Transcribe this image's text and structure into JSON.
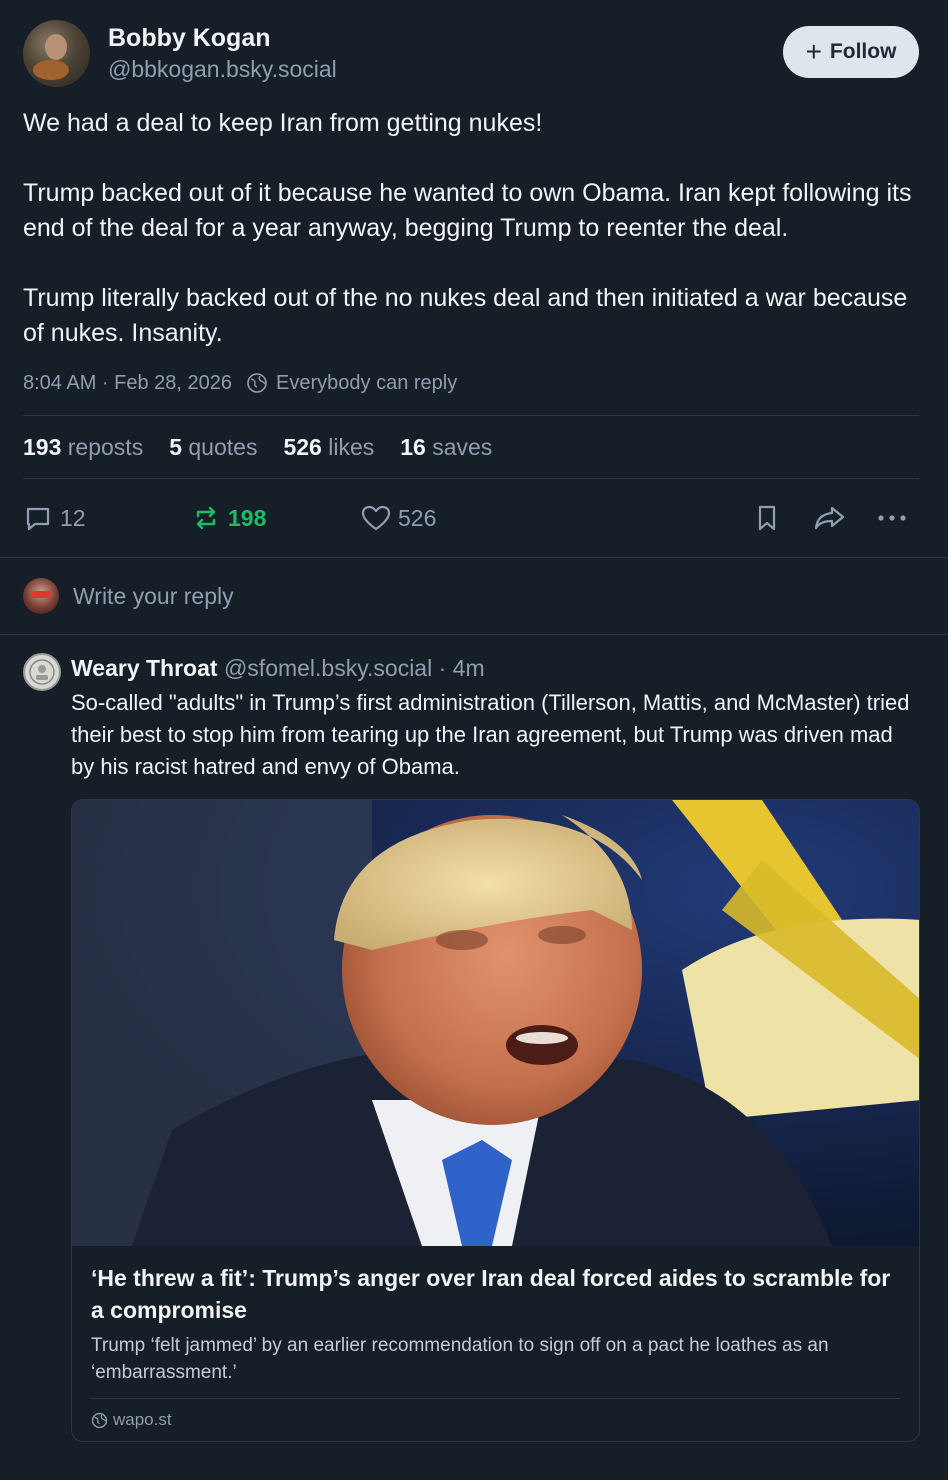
{
  "post": {
    "author": {
      "display_name": "Bobby Kogan",
      "handle": "@bbkogan.bsky.social"
    },
    "follow_label": "Follow",
    "paragraphs": [
      "We had a deal to keep Iran from getting nukes!",
      "Trump backed out of it because he wanted to own Obama. Iran kept following its end of the deal for a year anyway, begging Trump to reenter the deal.",
      "Trump literally backed out of the no nukes deal and then initiated a war because of nukes. Insanity."
    ],
    "timestamp": "8:04 AM · Feb 28, 2026",
    "reply_setting": "Everybody can reply",
    "stats": {
      "reposts_count": "193",
      "reposts_label": "reposts",
      "quotes_count": "5",
      "quotes_label": "quotes",
      "likes_count": "526",
      "likes_label": "likes",
      "saves_count": "16",
      "saves_label": "saves"
    },
    "actions": {
      "replies": "12",
      "reposts": "198",
      "likes": "526"
    },
    "colors": {
      "repost_active": "#20bc63",
      "background": "#161e27"
    }
  },
  "composer": {
    "placeholder": "Write your reply"
  },
  "reply": {
    "display_name": "Weary Throat",
    "handle": "@sfomel.bsky.social",
    "time": "· 4m",
    "text": "So-called \"adults\" in Trump’s first administration (Tillerson, Mattis, and McMaster) tried their best to stop him from tearing up the Iran agreement, but Trump was driven mad by his racist hatred and envy of Obama.",
    "card": {
      "title": "‘He threw a fit’: Trump’s anger over Iran deal forced aides to scramble for a compromise",
      "description": "Trump ‘felt jammed’ by an earlier recommendation to sign off on a pact he loathes as an ‘embarrassment.’",
      "domain": "wapo.st"
    }
  }
}
